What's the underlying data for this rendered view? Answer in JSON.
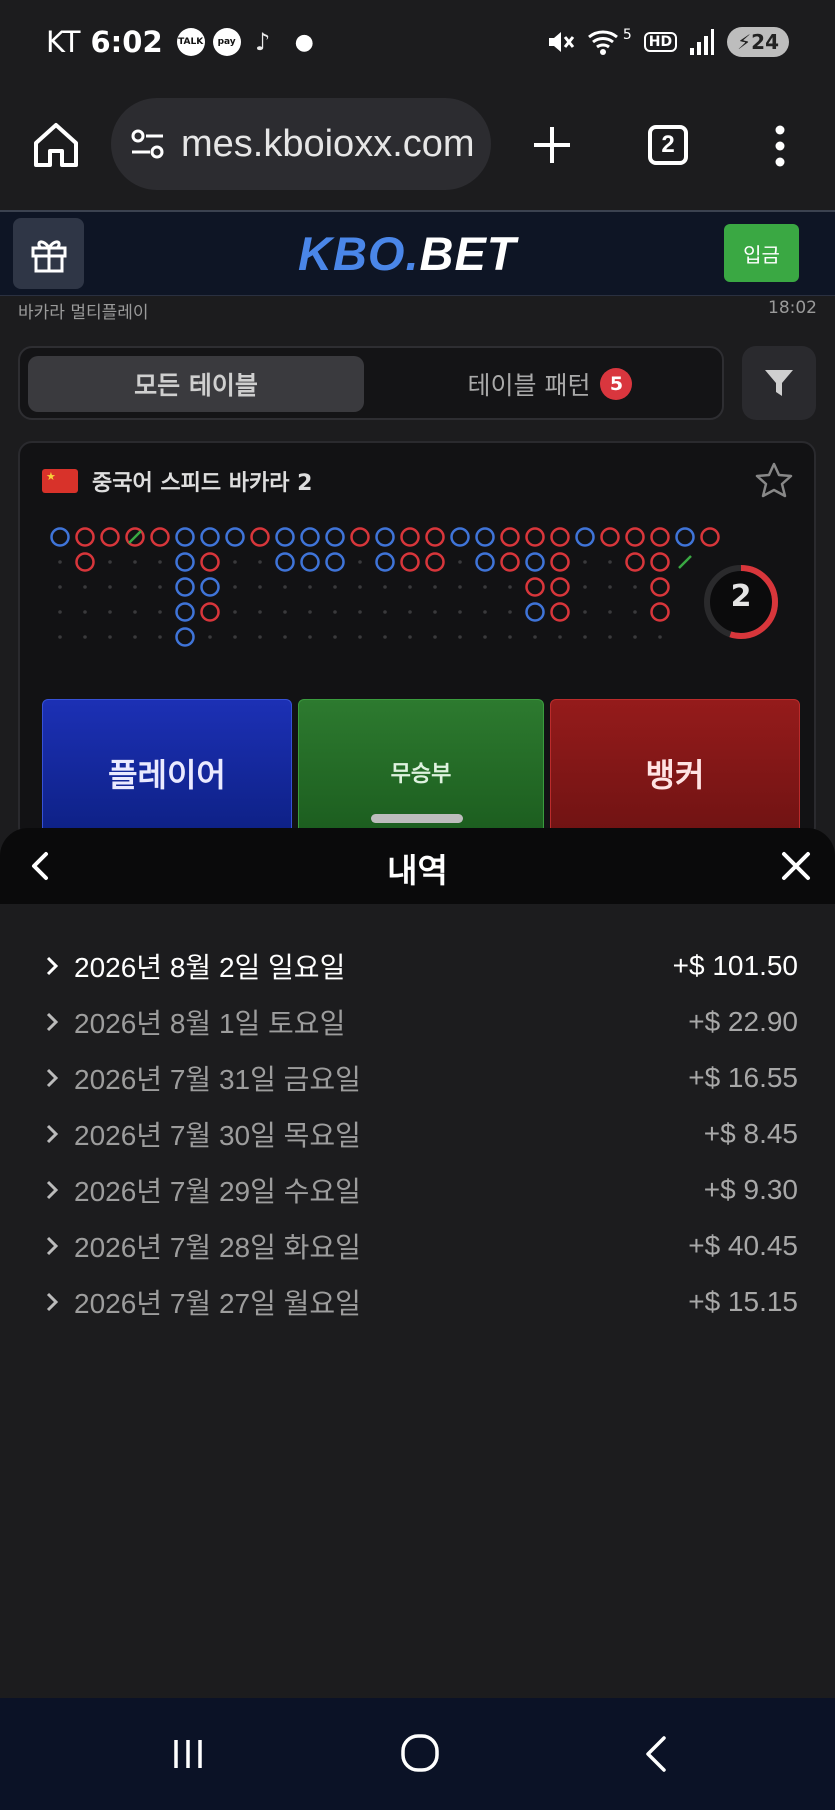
{
  "status_bar": {
    "carrier": "KT",
    "time": "6:02",
    "icons": [
      "talk-icon",
      "pay-icon",
      "tiktok-icon",
      "dot-icon"
    ],
    "talk_label": "TALK",
    "pay_label": "pay",
    "network": "5",
    "hd_label": "HD",
    "battery": "24"
  },
  "browser": {
    "url": "mes.kboioxx.com",
    "tab_count": "2"
  },
  "site": {
    "logo_kbo": "KBO",
    "logo_dot": ".",
    "logo_bet": "BET",
    "deposit_label": "입금",
    "breadcrumb": "바카라 멀티플레이",
    "clock": "18:02"
  },
  "tabs": {
    "all_label": "모든 테이블",
    "pattern_label": "테이블 패턴",
    "pattern_badge": "5"
  },
  "table": {
    "name": "중국어 스피드 바카라 2",
    "count": "2",
    "count_progress": 0.55,
    "colors": {
      "player": "#3f74d8",
      "banker": "#d8363b",
      "tie": "#3aa843"
    },
    "player_label": "플레이어",
    "tie_label": "무승부",
    "banker_label": "뱅커"
  },
  "sheet": {
    "title": "내역",
    "history": [
      {
        "date": "2026년 8월 2일 일요일",
        "amount": "+$ 101.50"
      },
      {
        "date": "2026년 8월 1일 토요일",
        "amount": "+$ 22.90"
      },
      {
        "date": "2026년 7월 31일 금요일",
        "amount": "+$ 16.55"
      },
      {
        "date": "2026년 7월 30일 목요일",
        "amount": "+$ 8.45"
      },
      {
        "date": "2026년 7월 29일 수요일",
        "amount": "+$ 9.30"
      },
      {
        "date": "2026년 7월 28일 화요일",
        "amount": "+$ 40.45"
      },
      {
        "date": "2026년 7월 27일 월요일",
        "amount": "+$ 15.15"
      }
    ]
  }
}
